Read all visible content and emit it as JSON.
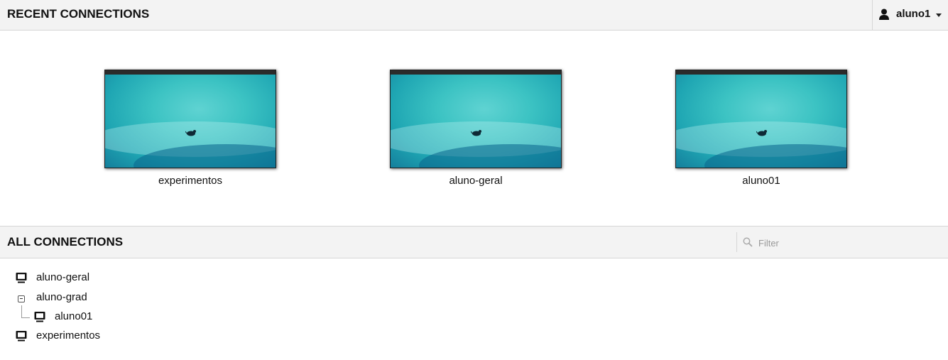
{
  "header": {
    "title": "RECENT CONNECTIONS",
    "user_icon": "user-icon",
    "username": "aluno1",
    "menu_icon": "caret-down-icon"
  },
  "recent": [
    {
      "label": "experimentos"
    },
    {
      "label": "aluno-geral"
    },
    {
      "label": "aluno01"
    }
  ],
  "all": {
    "title": "ALL CONNECTIONS",
    "filter_placeholder": "Filter",
    "filter_icon": "search-icon",
    "tree": [
      {
        "label": "aluno-geral",
        "icon": "monitor-icon"
      },
      {
        "label": "aluno-grad",
        "icon": "collapse-toggle-icon",
        "expanded": true,
        "children": [
          {
            "label": "aluno01",
            "icon": "monitor-icon"
          }
        ]
      },
      {
        "label": "experimentos",
        "icon": "monitor-icon"
      }
    ]
  },
  "colors": {
    "bar": "#f3f3f3",
    "border": "#d6d6d6",
    "text": "#111111",
    "desktop": "#3cc3c3"
  }
}
